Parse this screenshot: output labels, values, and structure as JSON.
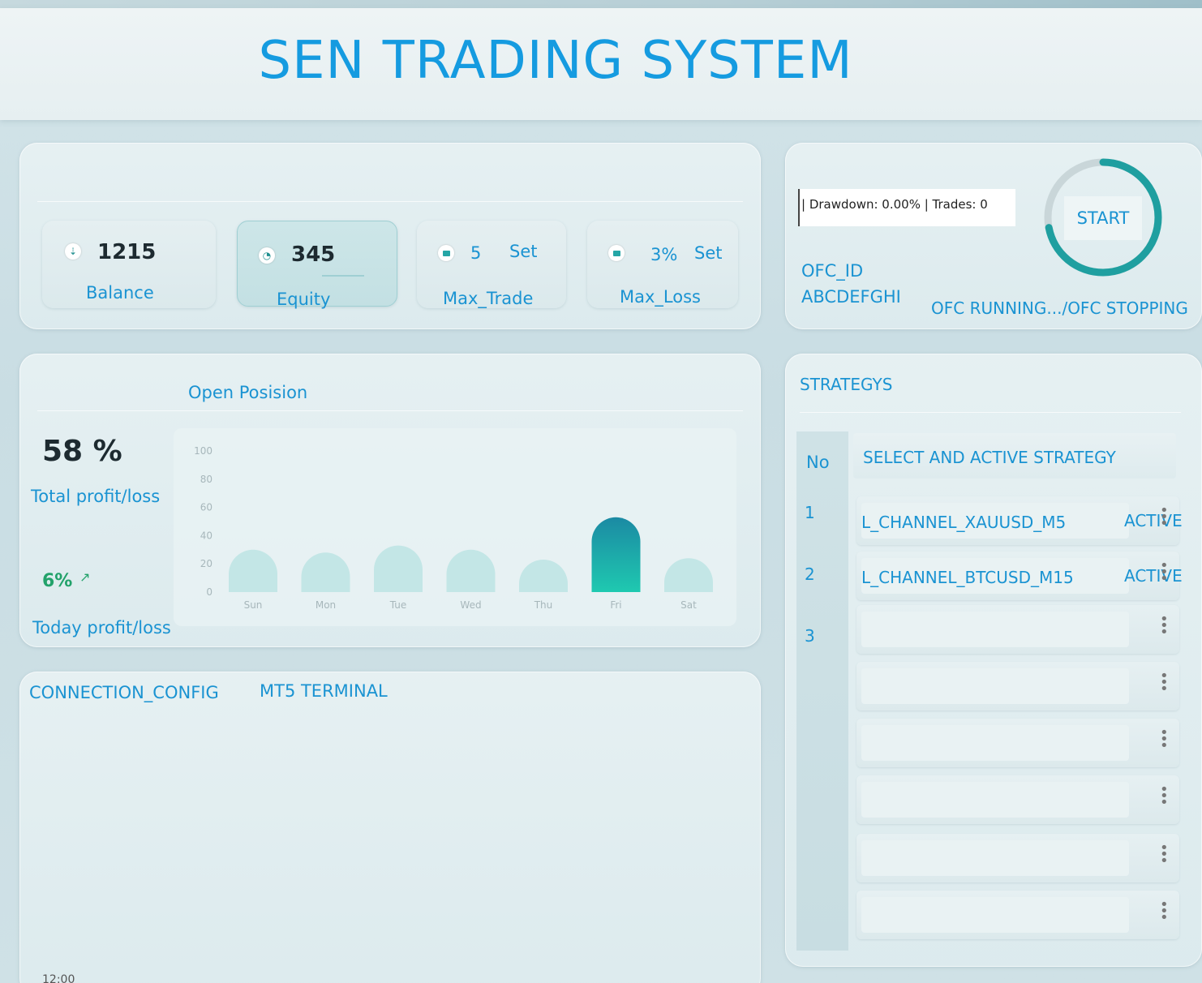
{
  "app": {
    "title": "SEN TRADING SYSTEM"
  },
  "stats": {
    "balance": {
      "value": "1215",
      "label": "Balance"
    },
    "equity": {
      "value": "345",
      "label": "Equity"
    },
    "max_trade": {
      "value": "5",
      "set_label": "Set",
      "label": "Max_Trade"
    },
    "max_loss": {
      "value": "3%",
      "set_label": "Set",
      "label": "Max_Loss"
    }
  },
  "status": {
    "drawdown_text": "| Drawdown: 0.00% | Trades: 0",
    "start_label": "START",
    "ofc_id_label": "OFC_ID",
    "ofc_id_value": "ABCDEFGHI",
    "ofc_status": "OFC RUNNING.../OFC STOPPING",
    "gauge_fraction": 0.72
  },
  "profit": {
    "section_title": "Open Posision",
    "total_value": "58 %",
    "total_label": "Total profit/loss",
    "today_value": "6%",
    "today_label": "Today profit/loss"
  },
  "chart_data": {
    "type": "bar",
    "categories": [
      "Sun",
      "Mon",
      "Tue",
      "Wed",
      "Thu",
      "Fri",
      "Sat"
    ],
    "values": [
      30,
      28,
      33,
      30,
      23,
      53,
      24
    ],
    "highlight_index": 5,
    "yticks": [
      "100",
      "80",
      "60",
      "40",
      "20",
      "0"
    ],
    "ylim": [
      0,
      100
    ],
    "colors": {
      "bar": "#c3e6e6",
      "highlight_top": "#1b8aa3",
      "highlight_bottom": "#1fc9b0"
    }
  },
  "connection": {
    "config_label": "CONNECTION_CONFIG",
    "terminal_label": "MT5 TERMINAL",
    "footer_time": "12:00"
  },
  "strategies": {
    "title": "STRATEGYS",
    "col_no": "No",
    "col_select": "SELECT AND ACTIVE STRATEGY",
    "rows": [
      {
        "no": "1",
        "name": "L_CHANNEL_XAUUSD_M5",
        "status": "ACTIVE"
      },
      {
        "no": "2",
        "name": "L_CHANNEL_BTCUSD_M15",
        "status": "ACTIVE"
      },
      {
        "no": "3",
        "name": "",
        "status": ""
      },
      {
        "no": "",
        "name": "",
        "status": ""
      },
      {
        "no": "",
        "name": "",
        "status": ""
      },
      {
        "no": "",
        "name": "",
        "status": ""
      },
      {
        "no": "",
        "name": "",
        "status": ""
      },
      {
        "no": "",
        "name": "",
        "status": ""
      }
    ]
  },
  "theme": {
    "accent": "#1a93d2",
    "teal": "#1f9fa0",
    "positive": "#22a26a"
  }
}
